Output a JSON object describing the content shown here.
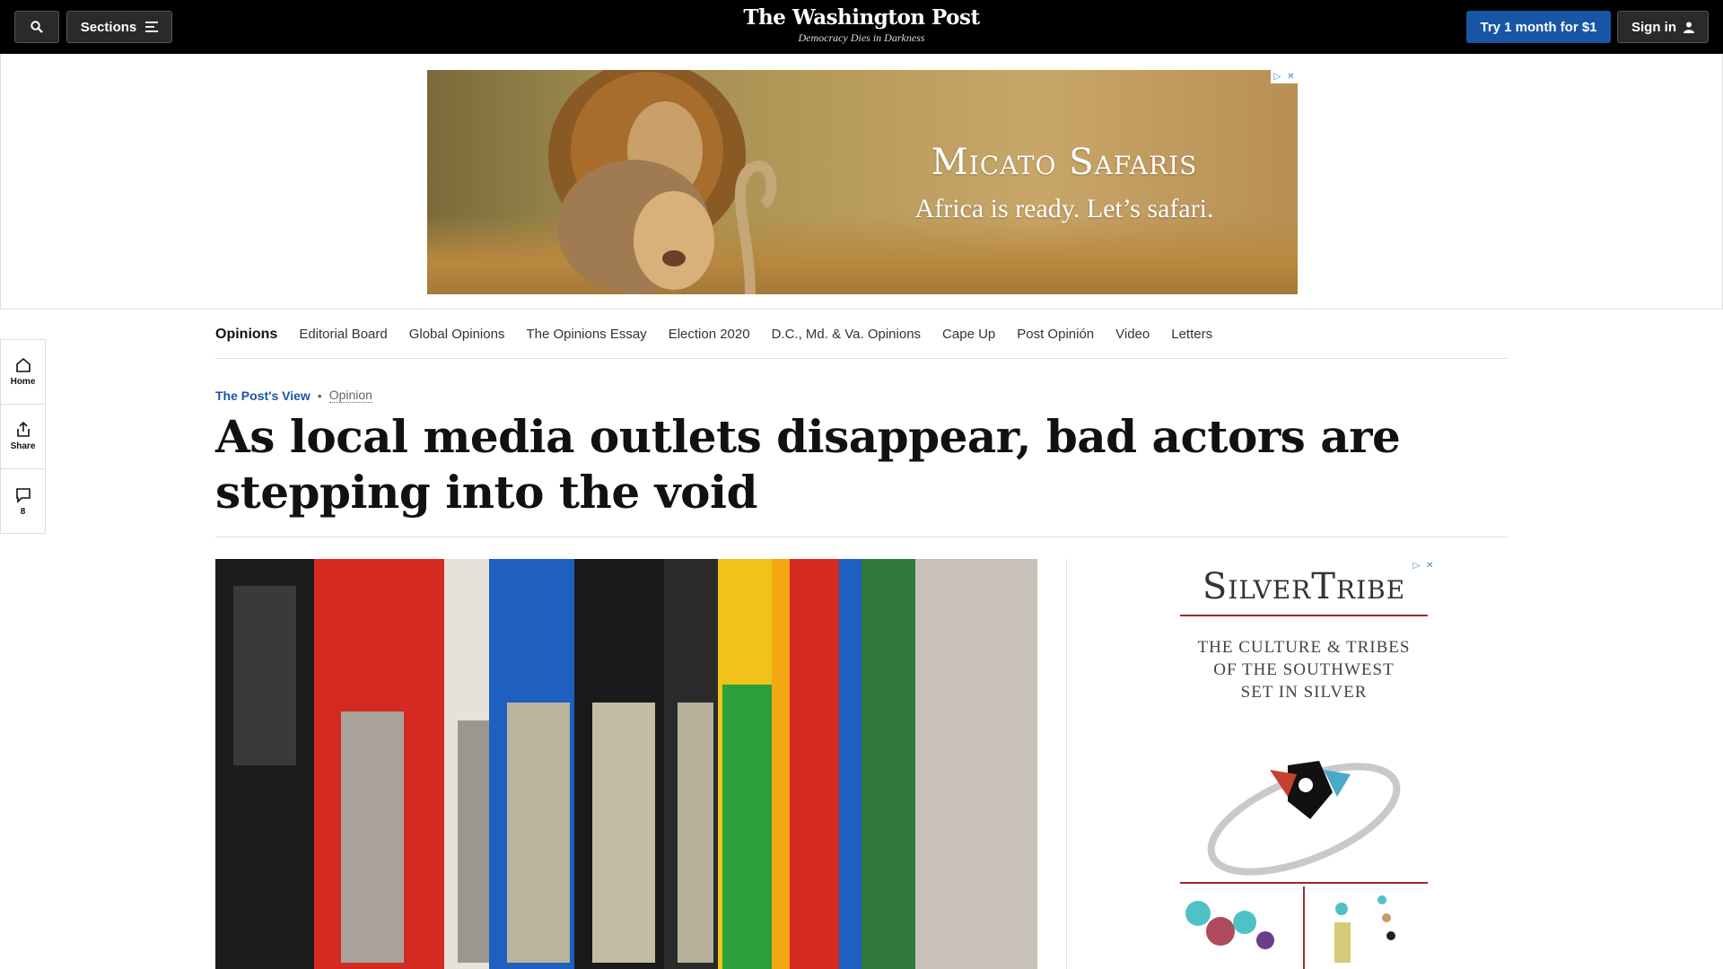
{
  "header": {
    "sections_label": "Sections",
    "logo_title": "The Washington Post",
    "logo_tagline": "Democracy Dies in Darkness",
    "subscribe_label": "Try 1 month for $1",
    "signin_label": "Sign in"
  },
  "top_ad": {
    "brand": "Micato Safaris",
    "slogan": "Africa is ready. Let’s safari."
  },
  "left_rail": {
    "home_label": "Home",
    "share_label": "Share",
    "comments_count": "8"
  },
  "subnav": {
    "items": [
      "Opinions",
      "Editorial Board",
      "Global Opinions",
      "The Opinions Essay",
      "Election 2020",
      "D.C., Md. & Va. Opinions",
      "Cape Up",
      "Post Opinión",
      "Video",
      "Letters"
    ]
  },
  "article": {
    "kicker": "The Post's View",
    "section": "Opinion",
    "headline": "As local media outlets disappear, bad actors are stepping into the void"
  },
  "right_ad": {
    "brand": "SilverTribe",
    "tagline_1": "THE CULTURE & TRIBES",
    "tagline_2": "OF THE SOUTHWEST",
    "tagline_3": "SET IN SILVER"
  },
  "colors": {
    "accent": "#1955a5",
    "topbar": "#000000",
    "silvertribe_red": "#a0282a"
  }
}
